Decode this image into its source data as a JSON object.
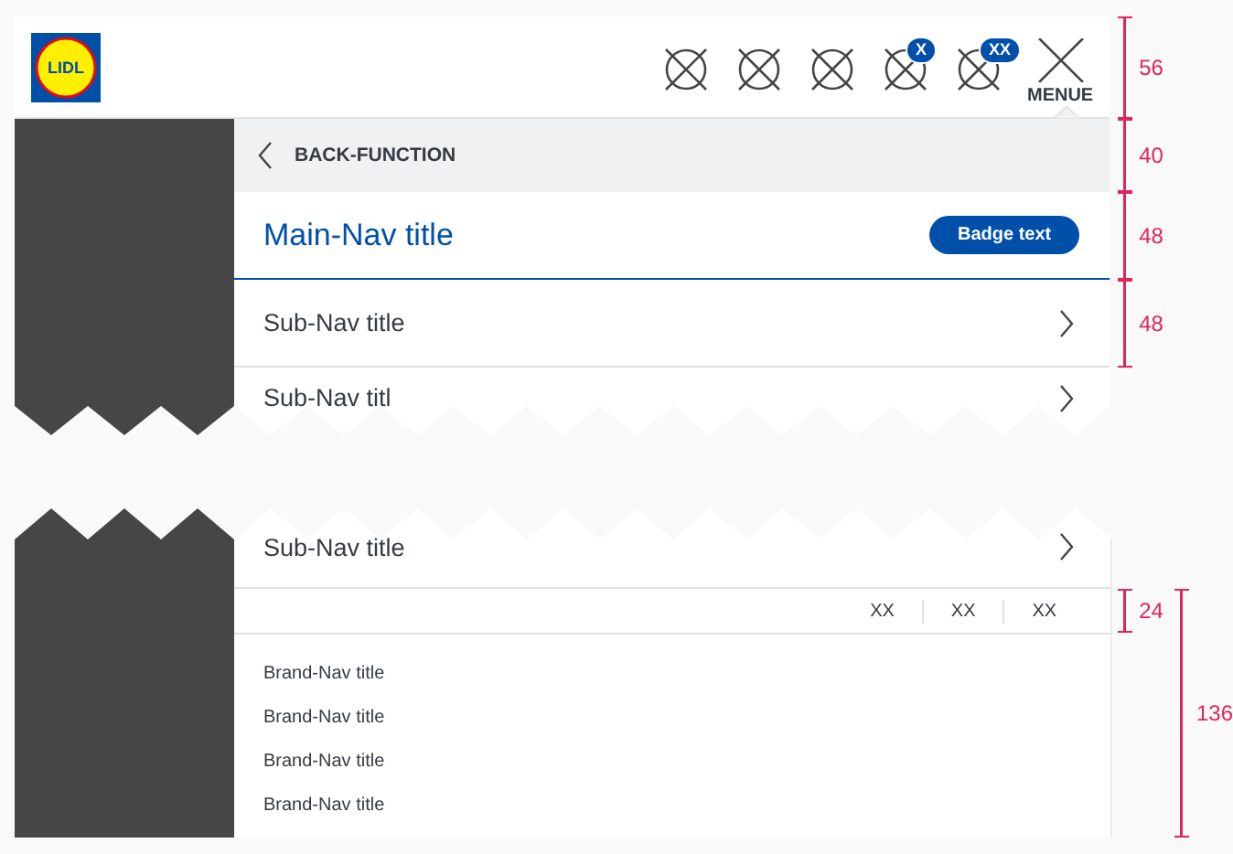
{
  "header": {
    "logo_text": "LIDL",
    "icons": [
      {
        "kind": "plain"
      },
      {
        "kind": "plain"
      },
      {
        "kind": "plain"
      },
      {
        "kind": "badged",
        "badge": "X"
      },
      {
        "kind": "badged",
        "badge": "XX"
      }
    ],
    "menu_button": {
      "label": "MENUE"
    }
  },
  "back": {
    "label": "BACK-FUNCTION"
  },
  "main_nav": {
    "title": "Main-Nav title",
    "badge": "Badge text"
  },
  "sub_nav_top": [
    {
      "title": "Sub-Nav title"
    },
    {
      "title": "Sub-Nav titl"
    }
  ],
  "sub_nav_bottom": [
    {
      "title": "Sub-Nav title"
    }
  ],
  "meta_links": [
    "XX",
    "XX",
    "XX"
  ],
  "brand_nav": [
    "Brand-Nav title",
    "Brand-Nav title",
    "Brand-Nav title",
    "Brand-Nav title"
  ],
  "annotations": {
    "header": "56",
    "back": "40",
    "main_nav": "48",
    "sub_nav": "48",
    "meta": "24",
    "brand": "136"
  }
}
